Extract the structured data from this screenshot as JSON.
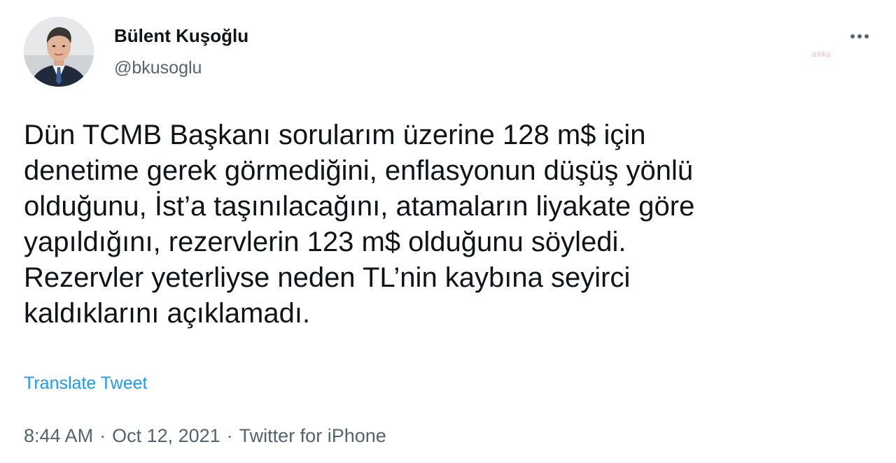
{
  "author": {
    "name": "Bülent Kuşoğlu",
    "handle": "@bkusoglu",
    "avatar_icon": "person-portrait-avatar"
  },
  "menu": {
    "icon": "more-horizontal-icon"
  },
  "watermark": {
    "text": "anka"
  },
  "tweet": {
    "lines": [
      "Dün TCMB Başkanı sorularım üzerine 128 m$ için",
      "denetime gerek görmediğini, enflasyonun düşüş yönlü",
      "olduğunu, İst’a taşınılacağını, atamaların liyakate göre",
      "yapıldığını, rezervlerin 123 m$ olduğunu söyledi.",
      "Rezervler yeterliyse neden TL’nin kaybına seyirci",
      "kaldıklarını açıklamadı."
    ],
    "translate_label": "Translate Tweet"
  },
  "meta": {
    "time": "8:44 AM",
    "separator": "·",
    "date": "Oct 12, 2021",
    "source": "Twitter for iPhone"
  },
  "colors": {
    "text": "#0f1419",
    "secondary": "#536471",
    "link": "#1d9bf0",
    "background": "#ffffff"
  }
}
